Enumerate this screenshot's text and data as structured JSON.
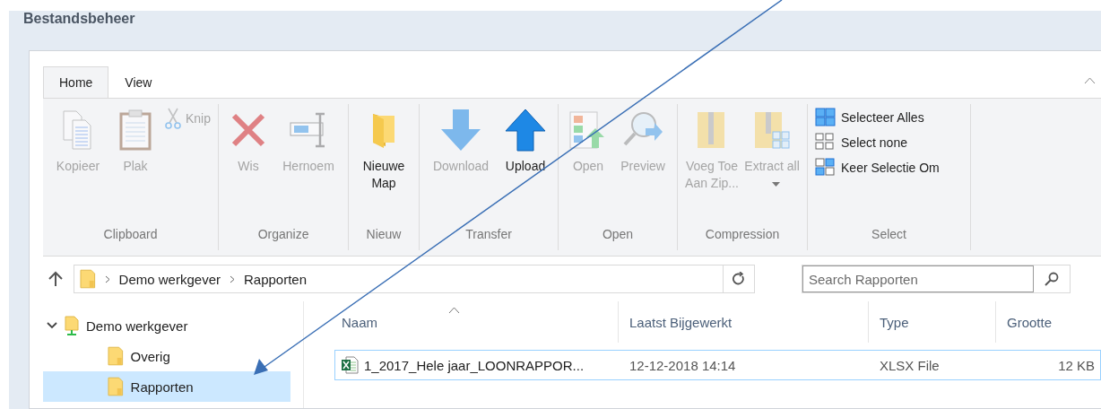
{
  "panel": {
    "title": "Bestandsbeheer"
  },
  "ribbon": {
    "tabs": [
      {
        "label": "Home",
        "selected": true
      },
      {
        "label": "View",
        "selected": false
      }
    ],
    "groups": [
      {
        "label": "Clipboard",
        "items": [
          {
            "kind": "large",
            "label": "Kopieer",
            "disabled": true
          },
          {
            "kind": "large",
            "label": "Plak",
            "disabled": true
          },
          {
            "kind": "small",
            "label": "Knip",
            "disabled": true
          }
        ]
      },
      {
        "label": "Organize",
        "items": [
          {
            "kind": "large",
            "label": "Wis",
            "disabled": true
          },
          {
            "kind": "large",
            "label": "Hernoem",
            "disabled": true
          }
        ]
      },
      {
        "label": "Nieuw",
        "items": [
          {
            "kind": "large",
            "label": "Nieuwe Map",
            "disabled": false
          }
        ]
      },
      {
        "label": "Transfer",
        "items": [
          {
            "kind": "large",
            "label": "Download",
            "disabled": true
          },
          {
            "kind": "large",
            "label": "Upload",
            "disabled": false
          }
        ]
      },
      {
        "label": "Open",
        "items": [
          {
            "kind": "large",
            "label": "Open",
            "disabled": true
          },
          {
            "kind": "large",
            "label": "Preview",
            "disabled": true
          }
        ]
      },
      {
        "label": "Compression",
        "items": [
          {
            "kind": "large",
            "label": "Voeg Toe Aan Zip...",
            "disabled": true
          },
          {
            "kind": "large",
            "label": "Extract all",
            "disabled": true,
            "dropdown": true
          }
        ]
      },
      {
        "label": "Select",
        "items": [
          {
            "kind": "small",
            "label": "Selecteer Alles",
            "disabled": false
          },
          {
            "kind": "small",
            "label": "Select none",
            "disabled": false
          },
          {
            "kind": "small",
            "label": "Keer Selectie Om",
            "disabled": false
          }
        ]
      }
    ]
  },
  "address": {
    "path": [
      "Demo werkgever",
      "Rapporten"
    ]
  },
  "search": {
    "placeholder": "Search Rapporten"
  },
  "tree": [
    {
      "label": "Demo werkgever",
      "expanded": true,
      "selected": false,
      "children": [
        {
          "label": "Overig",
          "selected": false
        },
        {
          "label": "Rapporten",
          "selected": true
        }
      ]
    }
  ],
  "table": {
    "columns": [
      {
        "label": "Naam",
        "sorted": true
      },
      {
        "label": "Laatst Bijgewerkt",
        "sorted": false
      },
      {
        "label": "Type",
        "sorted": false
      },
      {
        "label": "Grootte",
        "sorted": false
      }
    ],
    "rows": [
      {
        "focused": true,
        "cells": [
          "1_2017_Hele jaar_LOONRAPPOR...",
          "12-12-2018 14:14",
          "XLSX File",
          "12 KB"
        ]
      }
    ]
  }
}
